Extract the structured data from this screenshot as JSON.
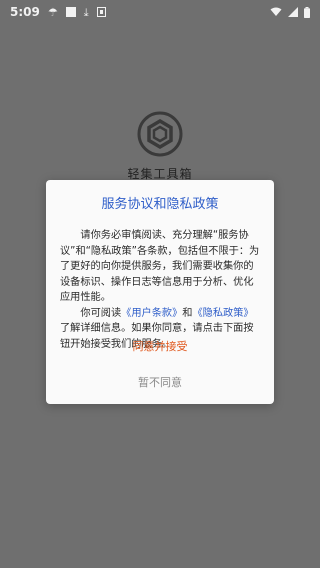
{
  "status_bar": {
    "time": "5:09"
  },
  "splash": {
    "app_name": "轻集工具箱"
  },
  "dialog": {
    "title": "服务协议和隐私政策",
    "paragraph1": "请你务必审慎阅读、充分理解“服务协议”和“隐私政策”各条款，包括但不限于：为了更好的向你提供服务，我们需要收集你的设备标识、操作日志等信息用于分析、优化应用性能。",
    "p2_before": "你可阅读",
    "user_terms_link": "《用户条款》",
    "p2_and": "和",
    "privacy_link": "《隐私政策》",
    "p2_after": "了解详细信息。如果你同意，请点击下面按钮开始接受我们的服务。",
    "agree_label": "同意并接受",
    "disagree_label": "暂不同意"
  },
  "colors": {
    "accent_blue": "#2f5ec9",
    "agree_orange": "#e0581e",
    "overlay_gray": "#6f6f6f"
  }
}
